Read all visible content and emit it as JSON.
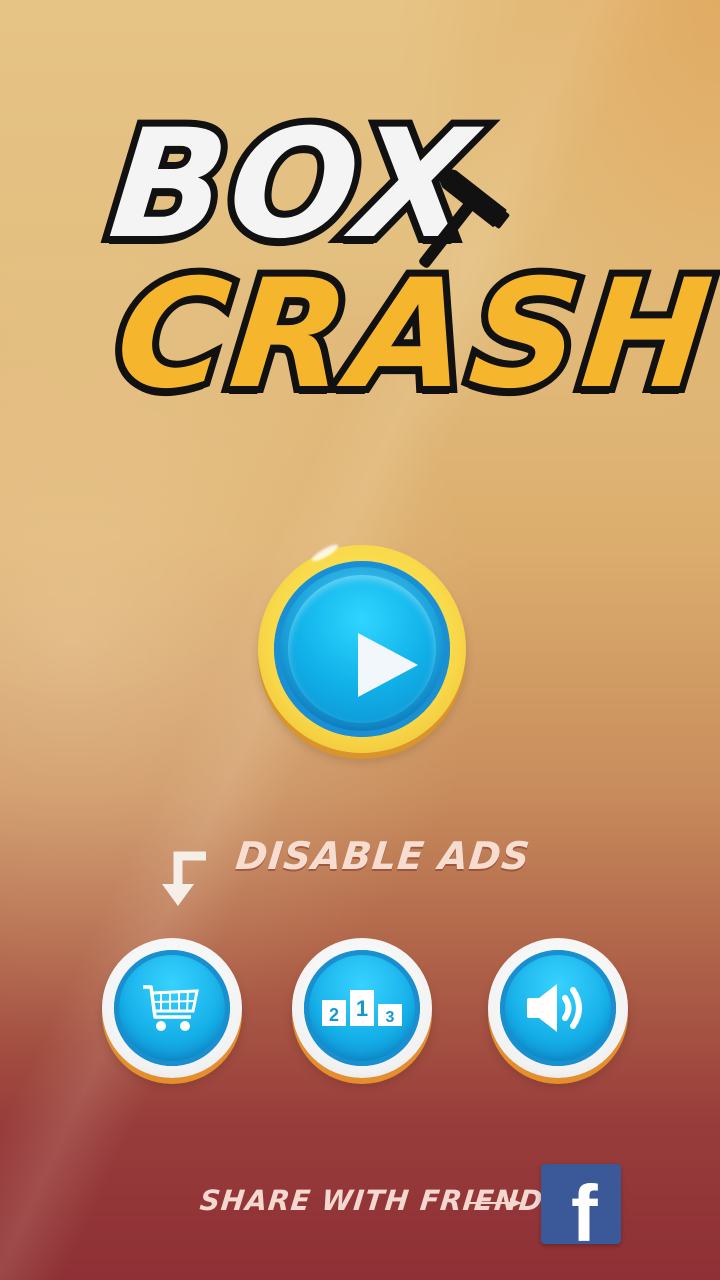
{
  "logo": {
    "line1": "BOX",
    "line2": "CRASH",
    "icon": "hammer-icon"
  },
  "play_button": {
    "icon": "play-icon"
  },
  "disable_ads": {
    "label": "DISABLE ADS",
    "icon": "arrow-down-left-icon"
  },
  "buttons": [
    {
      "name": "shop",
      "icon": "shopping-cart-icon"
    },
    {
      "name": "leaderboard",
      "icon": "podium-icon",
      "ranks": [
        "2",
        "1",
        "3"
      ]
    },
    {
      "name": "sound",
      "icon": "speaker-icon"
    }
  ],
  "share": {
    "label": "SHARE WITH FRIENDS",
    "icon": "arrow-right-icon",
    "facebook_icon": "facebook-icon",
    "facebook_glyph": "f"
  },
  "colors": {
    "play_ring": "#f8d94a",
    "button_blue": "#15afe8",
    "button_shadow": "#e48f2c",
    "facebook": "#3b5998",
    "logo_yellow": "#f5b62e",
    "logo_white": "#f4f4f4"
  }
}
